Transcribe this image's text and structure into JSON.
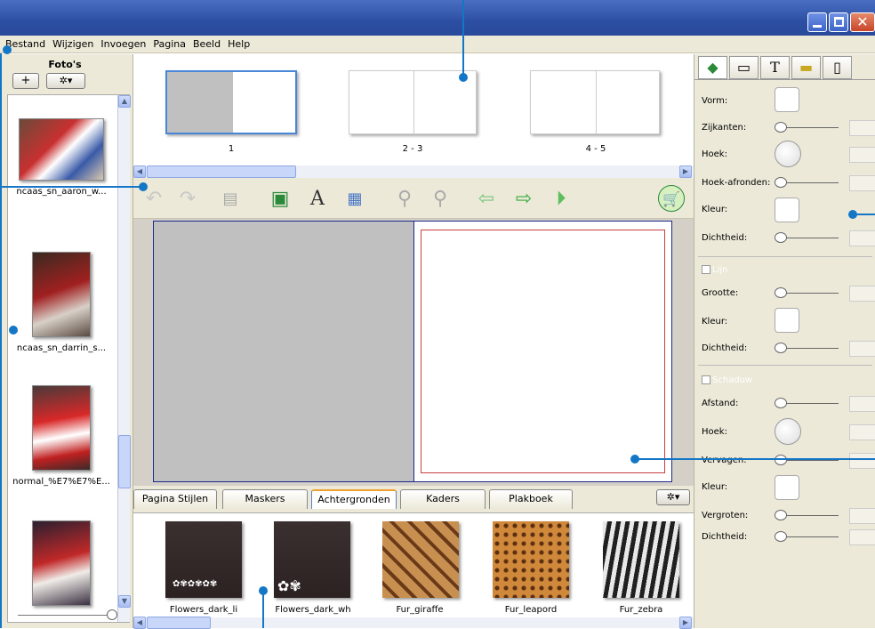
{
  "menu": [
    "Bestand",
    "Wijzigen",
    "Invoegen",
    "Pagina",
    "Beeld",
    "Help"
  ],
  "photos": {
    "title": "Foto's",
    "add_label": "+",
    "options_label": "✲▾",
    "items": [
      {
        "caption": "ncaas_sn_aaron_w..."
      },
      {
        "caption": "ncaas_sn_darrin_s..."
      },
      {
        "caption": "normal_%E7%E7%E..."
      },
      {
        "caption": ""
      }
    ]
  },
  "pages": [
    {
      "label": "1"
    },
    {
      "label": "2 - 3"
    },
    {
      "label": "4 - 5"
    }
  ],
  "tabs": [
    "Pagina Stijlen",
    "Maskers",
    "Achtergronden",
    "Kaders",
    "Plakboek"
  ],
  "active_tab": "Achtergronden",
  "backgrounds": [
    {
      "caption": "Flowers_dark_li"
    },
    {
      "caption": "Flowers_dark_wh"
    },
    {
      "caption": "Fur_giraffe"
    },
    {
      "caption": "Fur_leapord"
    },
    {
      "caption": "Fur_zebra"
    }
  ],
  "props": {
    "vorm": "Vorm:",
    "zijkanten": "Zijkanten:",
    "hoek": "Hoek:",
    "hoek_afronden": "Hoek-afronden:",
    "kleur": "Kleur:",
    "dichtheid": "Dichtheid:",
    "lijn": "Lijn",
    "grootte": "Grootte:",
    "kleur2": "Kleur:",
    "dichtheid2": "Dichtheid:",
    "schaduw": "Schaduw",
    "afstand": "Afstand:",
    "hoek2": "Hoek:",
    "vervagen": "Vervagen:",
    "kleur3": "Kleur:",
    "vergroten": "Vergroten:",
    "dichtheid3": "Dichtheid:"
  },
  "colors": {
    "accent": "#1476c6",
    "titlebar": "#2c4fa3",
    "panel": "#ece9d8"
  }
}
